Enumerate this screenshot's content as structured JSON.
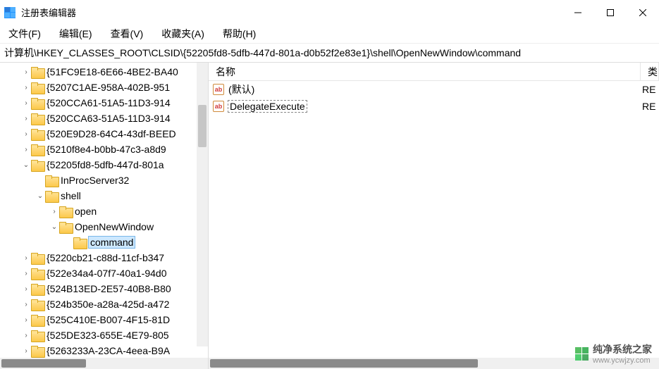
{
  "window": {
    "title": "注册表编辑器"
  },
  "menu": {
    "file": "文件(F)",
    "edit": "编辑(E)",
    "view": "查看(V)",
    "favorites": "收藏夹(A)",
    "help": "帮助(H)"
  },
  "address": "计算机\\HKEY_CLASSES_ROOT\\CLSID\\{52205fd8-5dfb-447d-801a-d0b52f2e83e1}\\shell\\OpenNewWindow\\command",
  "tree": [
    {
      "depth": 1,
      "caret": "right",
      "label": "{51FC9E18-6E66-4BE2-BA40"
    },
    {
      "depth": 1,
      "caret": "right",
      "label": "{5207C1AE-958A-402B-951"
    },
    {
      "depth": 1,
      "caret": "right",
      "label": "{520CCA61-51A5-11D3-914"
    },
    {
      "depth": 1,
      "caret": "right",
      "label": "{520CCA63-51A5-11D3-914"
    },
    {
      "depth": 1,
      "caret": "right",
      "label": "{520E9D28-64C4-43df-BEED"
    },
    {
      "depth": 1,
      "caret": "right",
      "label": "{5210f8e4-b0bb-47c3-a8d9"
    },
    {
      "depth": 1,
      "caret": "down",
      "label": "{52205fd8-5dfb-447d-801a"
    },
    {
      "depth": 2,
      "caret": "none",
      "label": "InProcServer32"
    },
    {
      "depth": 2,
      "caret": "down",
      "label": "shell"
    },
    {
      "depth": 3,
      "caret": "right",
      "label": "open"
    },
    {
      "depth": 3,
      "caret": "down",
      "label": "OpenNewWindow"
    },
    {
      "depth": 4,
      "caret": "none",
      "label": "command",
      "selected": true
    },
    {
      "depth": 1,
      "caret": "right",
      "label": "{5220cb21-c88d-11cf-b347"
    },
    {
      "depth": 1,
      "caret": "right",
      "label": "{522e34a4-07f7-40a1-94d0"
    },
    {
      "depth": 1,
      "caret": "right",
      "label": "{524B13ED-2E57-40B8-B80"
    },
    {
      "depth": 1,
      "caret": "right",
      "label": "{524b350e-a28a-425d-a472"
    },
    {
      "depth": 1,
      "caret": "right",
      "label": "{525C410E-B007-4F15-81D"
    },
    {
      "depth": 1,
      "caret": "right",
      "label": "{525DE323-655E-4E79-805"
    },
    {
      "depth": 1,
      "caret": "right",
      "label": "{5263233A-23CA-4eea-B9A"
    }
  ],
  "list": {
    "headers": {
      "name": "名称",
      "type": "类"
    },
    "rows": [
      {
        "icon": "ab",
        "name": "(默认)",
        "type": "RE",
        "selected": false
      },
      {
        "icon": "ab",
        "name": "DelegateExecute",
        "type": "RE",
        "selected": true
      }
    ]
  },
  "watermark": {
    "name": "纯净系统之家",
    "url": "www.ycwjzy.com"
  }
}
